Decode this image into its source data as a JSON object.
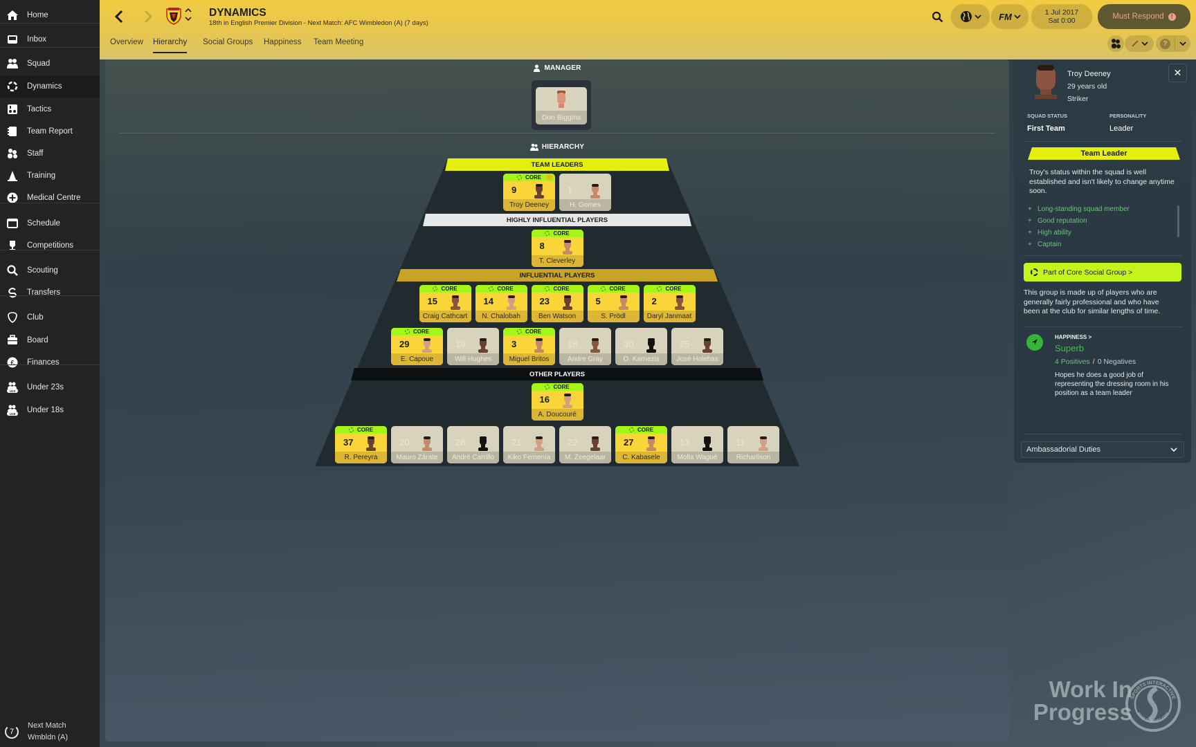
{
  "sidebar": {
    "items": [
      {
        "label": "Home",
        "icon": "home-icon"
      },
      {
        "label": "Inbox",
        "icon": "inbox-icon"
      },
      {
        "label": "Squad",
        "icon": "squad-icon"
      },
      {
        "label": "Dynamics",
        "icon": "dynamics-icon",
        "active": true
      },
      {
        "label": "Tactics",
        "icon": "tactics-icon"
      },
      {
        "label": "Team Report",
        "icon": "team-report-icon"
      },
      {
        "label": "Staff",
        "icon": "staff-icon"
      },
      {
        "label": "Training",
        "icon": "training-cone-icon"
      },
      {
        "label": "Medical Centre",
        "icon": "medical-plus-icon"
      },
      {
        "label": "Schedule",
        "icon": "calendar-icon"
      },
      {
        "label": "Competitions",
        "icon": "trophy-icon"
      },
      {
        "label": "Scouting",
        "icon": "magnifier-icon"
      },
      {
        "label": "Transfers",
        "icon": "transfers-icon"
      },
      {
        "label": "Club",
        "icon": "shield-icon"
      },
      {
        "label": "Board",
        "icon": "briefcase-icon"
      },
      {
        "label": "Finances",
        "icon": "pound-icon"
      },
      {
        "label": "Under 23s",
        "icon": "u23-icon",
        "badge": "U23"
      },
      {
        "label": "Under 18s",
        "icon": "u18-icon",
        "badge": "U18"
      }
    ],
    "next_match": {
      "days": "7",
      "title": "Next Match",
      "opponent": "Wmbldn (A)"
    }
  },
  "header": {
    "title": "DYNAMICS",
    "subtitle": "18th in English Premier Division - Next Match: AFC Wimbledon (A) (7 days)",
    "tabs": [
      {
        "label": "Overview"
      },
      {
        "label": "Hierarchy",
        "active": true
      },
      {
        "label": "Social Groups"
      },
      {
        "label": "Happiness"
      },
      {
        "label": "Team Meeting"
      }
    ],
    "date_line1": "1 Jul 2017",
    "date_line2": "Sat 0:00",
    "must_respond": "Must Respond",
    "fm_label": "FM"
  },
  "manager": {
    "heading": "MANAGER",
    "name": "Don Biggins"
  },
  "hierarchy": {
    "heading": "HIERARCHY",
    "core_label": "CORE",
    "tiers": [
      {
        "label": "TEAM LEADERS",
        "rows": [
          [
            {
              "number": "9",
              "name": "Troy Deeney",
              "core": true,
              "captain": true
            },
            {
              "number": "1",
              "name": "H. Gomes",
              "core": false
            }
          ]
        ]
      },
      {
        "label": "HIGHLY INFLUENTIAL PLAYERS",
        "rows": [
          [
            {
              "number": "8",
              "name": "T. Cleverley",
              "core": true
            }
          ]
        ]
      },
      {
        "label": "INFLUENTIAL PLAYERS",
        "rows": [
          [
            {
              "number": "15",
              "name": "Craig Cathcart",
              "core": true
            },
            {
              "number": "14",
              "name": "N. Chalobah",
              "core": true
            },
            {
              "number": "23",
              "name": "Ben Watson",
              "core": true
            },
            {
              "number": "5",
              "name": "S. Prödl",
              "core": true
            },
            {
              "number": "2",
              "name": "Daryl Janmaat",
              "core": true
            }
          ],
          [
            {
              "number": "29",
              "name": "E. Capoue",
              "core": true
            },
            {
              "number": "19",
              "name": "Will Hughes",
              "core": false
            },
            {
              "number": "3",
              "name": "Miguel Britos",
              "core": true
            },
            {
              "number": "18",
              "name": "Andre Gray",
              "core": false
            },
            {
              "number": "30",
              "name": "O. Karnezis",
              "core": false,
              "silhouette": true
            },
            {
              "number": "25",
              "name": "José Holebas",
              "core": false
            }
          ]
        ]
      },
      {
        "label": "OTHER PLAYERS",
        "rows": [
          [
            {
              "number": "16",
              "name": "A. Doucouré",
              "core": true
            }
          ],
          [
            {
              "number": "37",
              "name": "R. Pereyra",
              "core": true
            },
            {
              "number": "20",
              "name": "Mauro Zárate",
              "core": false
            },
            {
              "number": "28",
              "name": "André Carrillo",
              "core": false,
              "silhouette": true
            },
            {
              "number": "21",
              "name": "Kiko Femenía",
              "core": false
            },
            {
              "number": "22",
              "name": "M. Zeegelaar",
              "core": false
            },
            {
              "number": "27",
              "name": "C. Kabasele",
              "core": true
            },
            {
              "number": "13",
              "name": "Molla Wagué",
              "core": false,
              "silhouette": true
            },
            {
              "number": "11",
              "name": "Richarlison",
              "core": false
            }
          ]
        ]
      }
    ],
    "colors": {
      "team_leaders": "#e4ef0e",
      "highly_influential": "#e6e8e8",
      "influential": "#c9a326",
      "other": "#0d0f10",
      "core_tag": "#a6f518",
      "core_card": "#f9d53a",
      "plain_card": "#d8d3bd"
    }
  },
  "side_panel": {
    "name": "Troy Deeney",
    "age": "29 years old",
    "position": "Striker",
    "squad_status_label": "SQUAD STATUS",
    "squad_status": "First Team",
    "personality_label": "PERSONALITY",
    "personality": "Leader",
    "role": "Team Leader",
    "role_desc": "Troy's status within the squad is well established and isn't likely to change anytime soon.",
    "reasons": [
      "Long-standing squad member",
      "Good reputation",
      "High ability",
      "Captain"
    ],
    "social_group_button": "Part of Core Social Group >",
    "social_group_desc": "This group is made up of players who are generally fairly professional and who have been at the club for similar lengths of time.",
    "happiness_label": "HAPPINESS >",
    "happiness_value": "Superb",
    "positives": "4 Positives",
    "separator": "/",
    "negatives": "0 Negatives",
    "happiness_desc": "Hopes he does a good job of representing the dressing room in his position as a team leader",
    "duties_select": "Ambassadorial Duties"
  },
  "watermark": {
    "line1": "Work In",
    "line2": "Progress",
    "logo_text_top": "SPORTS INTERACTIVE",
    "logo_text_bottom": "www.sigames.com"
  }
}
